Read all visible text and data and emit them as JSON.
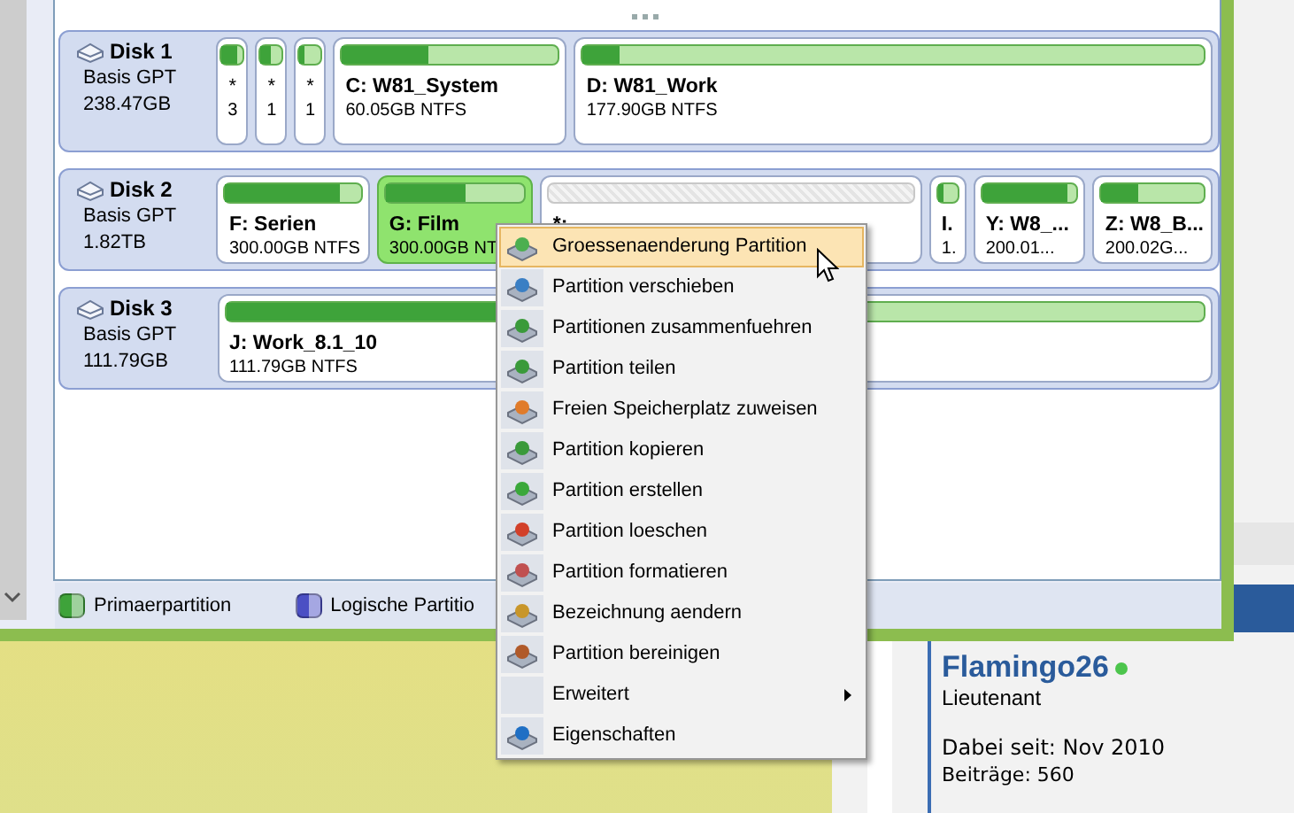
{
  "disks": [
    {
      "name": "Disk 1",
      "type": "Basis GPT",
      "size": "238.47GB",
      "partitions": [
        {
          "kind": "small",
          "selected": false,
          "level": 0.75,
          "lines": [
            "*",
            "3"
          ]
        },
        {
          "kind": "small",
          "selected": false,
          "level": 0.45,
          "lines": [
            "*",
            "1"
          ]
        },
        {
          "kind": "small",
          "selected": false,
          "level": 0.2,
          "lines": [
            "*",
            "1"
          ]
        },
        {
          "kind": "primary",
          "selected": false,
          "level": 0.4,
          "lines": [
            "C: W81_System",
            "60.05GB NTFS"
          ]
        },
        {
          "kind": "primary",
          "selected": false,
          "level": 0.06,
          "lines": [
            "D: W81_Work",
            "177.90GB NTFS"
          ]
        }
      ]
    },
    {
      "name": "Disk 2",
      "type": "Basis GPT",
      "size": "1.82TB",
      "partitions": [
        {
          "kind": "primary",
          "selected": false,
          "level": 0.85,
          "lines": [
            "F: Serien",
            "300.00GB NTFS"
          ]
        },
        {
          "kind": "primary",
          "selected": true,
          "level": 0.58,
          "lines": [
            "G: Film",
            "300.00GB NT"
          ]
        },
        {
          "kind": "unallocated",
          "selected": false,
          "lines": [
            "*:"
          ]
        },
        {
          "kind": "primary",
          "selected": false,
          "level": 0.3,
          "lines": [
            "I.",
            "1."
          ]
        },
        {
          "kind": "primary",
          "selected": false,
          "level": 0.9,
          "lines": [
            "Y: W8_...",
            "200.01..."
          ]
        },
        {
          "kind": "primary",
          "selected": false,
          "level": 0.35,
          "lines": [
            "Z: W8_B...",
            "200.02G..."
          ]
        }
      ]
    },
    {
      "name": "Disk 3",
      "type": "Basis GPT",
      "size": "111.79GB",
      "partitions": [
        {
          "kind": "primary",
          "selected": false,
          "level": 0.31,
          "lines": [
            "J: Work_8.1_10",
            "111.79GB NTFS"
          ]
        }
      ]
    }
  ],
  "legend": [
    {
      "label": "Primaerpartition",
      "color": "#3ea33a"
    },
    {
      "label": "Logische Partitio",
      "color": "#4b4fc4"
    }
  ],
  "context_menu": [
    {
      "kind": "action",
      "label": "Groessenaenderung Partition",
      "selected": true
    },
    {
      "kind": "action",
      "label": "Partition verschieben",
      "selected": false
    },
    {
      "kind": "action",
      "label": "Partitionen zusammenfuehren",
      "selected": false
    },
    {
      "kind": "action",
      "label": "Partition teilen",
      "selected": false
    },
    {
      "kind": "action",
      "label": "Freien Speicherplatz zuweisen",
      "selected": false
    },
    {
      "kind": "action",
      "label": "Partition kopieren",
      "selected": false
    },
    {
      "kind": "action",
      "label": "Partition erstellen",
      "selected": false
    },
    {
      "kind": "action",
      "label": "Partition loeschen",
      "selected": false
    },
    {
      "kind": "action",
      "label": "Partition formatieren",
      "selected": false
    },
    {
      "kind": "action",
      "label": "Bezeichnung aendern",
      "selected": false
    },
    {
      "kind": "action",
      "label": "Partition bereinigen",
      "selected": false
    },
    {
      "kind": "submenu",
      "label": "Erweitert",
      "selected": false
    },
    {
      "kind": "action",
      "label": "Eigenschaften",
      "selected": false
    }
  ],
  "forum_user": {
    "name": "Flamingo26",
    "online": true,
    "rank": "Lieutenant",
    "joined": "Dabei seit: Nov 2010",
    "posts": "Beiträge: 560"
  }
}
